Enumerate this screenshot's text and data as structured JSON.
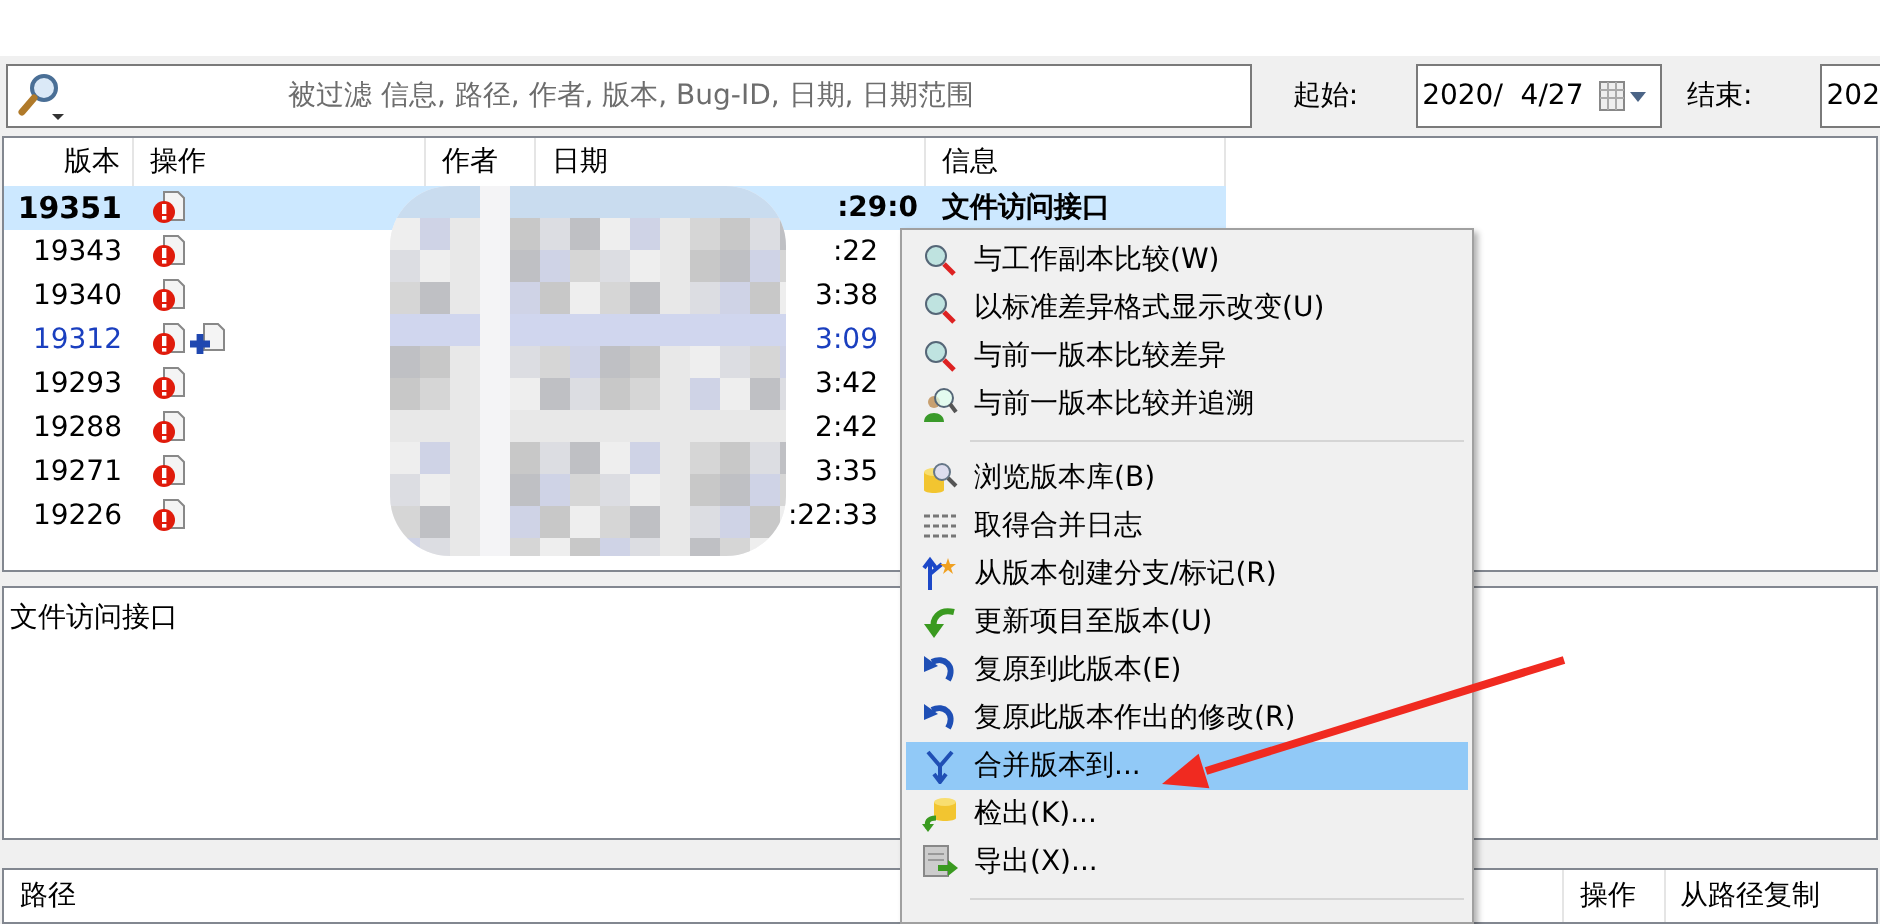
{
  "filter": {
    "placeholder": "被过滤 信息, 路径, 作者, 版本, Bug-ID, 日期, 日期范围"
  },
  "date_from": {
    "label": "起始:",
    "value": "2020/  4/27"
  },
  "date_to": {
    "label": "结束:",
    "value": "202"
  },
  "log": {
    "columns": [
      "版本",
      "操作",
      "作者",
      "日期",
      "信息"
    ],
    "rows": [
      {
        "revision": "19351",
        "actions": [
          {
            "kind": "modified"
          }
        ],
        "date": ":29:0",
        "message": "文件访问接口",
        "selected": true,
        "color": "#000000"
      },
      {
        "revision": "19343",
        "actions": [
          {
            "kind": "modified"
          }
        ],
        "date": ":22",
        "selected": false,
        "color": "#000000"
      },
      {
        "revision": "19340",
        "actions": [
          {
            "kind": "modified"
          }
        ],
        "date": "3:38",
        "selected": false,
        "color": "#000000"
      },
      {
        "revision": "19312",
        "actions": [
          {
            "kind": "modified"
          },
          {
            "kind": "added"
          }
        ],
        "date": "3:09",
        "selected": false,
        "color": "#1a3fbf"
      },
      {
        "revision": "19293",
        "actions": [
          {
            "kind": "modified"
          }
        ],
        "date": "3:42",
        "selected": false,
        "color": "#000000"
      },
      {
        "revision": "19288",
        "actions": [
          {
            "kind": "modified"
          }
        ],
        "date": "2:42",
        "selected": false,
        "color": "#000000"
      },
      {
        "revision": "19271",
        "actions": [
          {
            "kind": "modified"
          }
        ],
        "date": "3:35",
        "selected": false,
        "color": "#000000"
      },
      {
        "revision": "19226",
        "actions": [
          {
            "kind": "modified"
          }
        ],
        "date": ":22:33",
        "selected": false,
        "color": "#000000"
      }
    ]
  },
  "message_pane": {
    "text": "文件访问接口"
  },
  "paths": {
    "columns": [
      "路径",
      "操作",
      "从路径复制"
    ]
  },
  "context_menu": {
    "items": [
      {
        "kind": "diff",
        "label": "与工作副本比较(W)",
        "selected": false
      },
      {
        "kind": "diff",
        "label": "以标准差异格式显示改变(U)",
        "selected": false
      },
      {
        "kind": "diff",
        "label": "与前一版本比较差异",
        "selected": false
      },
      {
        "kind": "blame",
        "label": "与前一版本比较并追溯",
        "selected": false
      },
      {
        "kind": "separator"
      },
      {
        "kind": "repo",
        "label": "浏览版本库(B)",
        "selected": false
      },
      {
        "kind": "log",
        "label": "取得合并日志",
        "selected": false
      },
      {
        "kind": "branch",
        "label": "从版本创建分支/标记(R)",
        "selected": false
      },
      {
        "kind": "update",
        "label": "更新项目至版本(U)",
        "selected": false
      },
      {
        "kind": "revert",
        "label": "复原到此版本(E)",
        "selected": false
      },
      {
        "kind": "revert",
        "label": "复原此版本作出的修改(R)",
        "selected": false
      },
      {
        "kind": "merge",
        "label": "合并版本到...",
        "selected": true
      },
      {
        "kind": "checkout",
        "label": "检出(K)...",
        "selected": false
      },
      {
        "kind": "export",
        "label": "导出(X)...",
        "selected": false
      },
      {
        "kind": "separator"
      }
    ]
  }
}
